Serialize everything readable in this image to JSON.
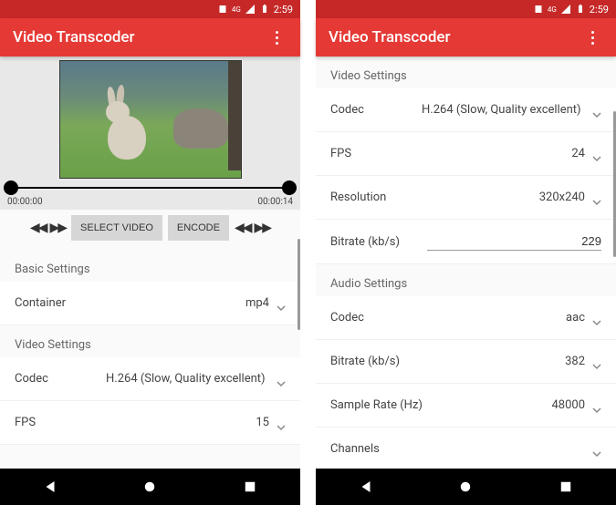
{
  "status": {
    "time": "2:59",
    "net": "4G"
  },
  "appbar": {
    "title": "Video Transcoder"
  },
  "left": {
    "timeline": {
      "start": "00:00:00",
      "end": "00:00:14"
    },
    "buttons": {
      "select": "SELECT VIDEO",
      "encode": "ENCODE"
    },
    "sections": {
      "basic": "Basic Settings",
      "video": "Video Settings"
    },
    "settings": {
      "container": {
        "label": "Container",
        "value": "mp4"
      },
      "codec": {
        "label": "Codec",
        "value": "H.264 (Slow, Quality excellent)"
      },
      "fps": {
        "label": "FPS",
        "value": "15"
      }
    }
  },
  "right": {
    "sections": {
      "video": "Video Settings",
      "audio": "Audio Settings"
    },
    "video": {
      "codec": {
        "label": "Codec",
        "value": "H.264 (Slow, Quality excellent)"
      },
      "fps": {
        "label": "FPS",
        "value": "24"
      },
      "resolution": {
        "label": "Resolution",
        "value": "320x240"
      },
      "bitrate": {
        "label": "Bitrate (kb/s)",
        "value": "229"
      }
    },
    "audio": {
      "codec": {
        "label": "Codec",
        "value": "aac"
      },
      "bitrate": {
        "label": "Bitrate (kb/s)",
        "value": "382"
      },
      "samplerate": {
        "label": "Sample Rate (Hz)",
        "value": "48000"
      },
      "channels": {
        "label": "Channels",
        "value": ""
      }
    }
  }
}
